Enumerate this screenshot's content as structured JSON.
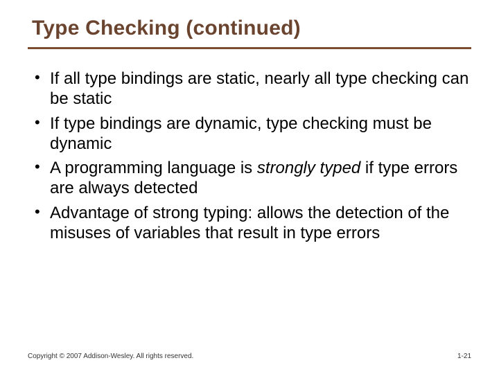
{
  "title": "Type Checking (continued)",
  "bullets": [
    {
      "text": "If all type bindings are static, nearly all type checking can be static"
    },
    {
      "text": "If type bindings are dynamic, type checking must be dynamic"
    },
    {
      "pre": "A programming language is ",
      "em": "strongly typed",
      "post": " if type errors are always detected"
    },
    {
      "text": "Advantage of strong typing: allows the detection of the misuses of variables that result in type errors"
    }
  ],
  "footer": {
    "copyright": "Copyright © 2007 Addison-Wesley. All rights reserved.",
    "page": "1-21"
  }
}
